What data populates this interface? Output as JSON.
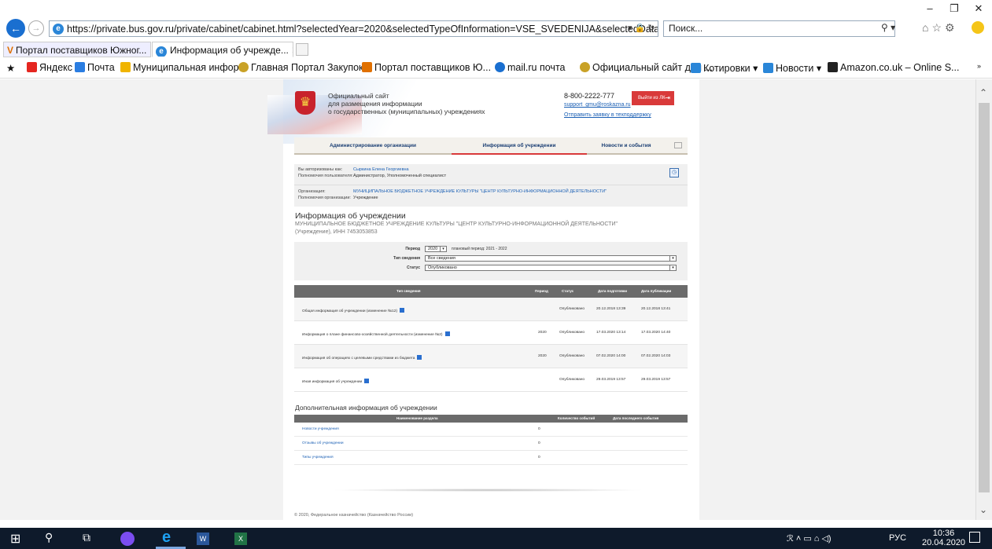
{
  "browser": {
    "url": "https://private.bus.gov.ru/private/cabinet/cabinet.html?selectedYear=2020&selectedTypeOfInformation=VSE_SVEDENIJA&selectedDataStatus=F",
    "search_placeholder": "Поиск...",
    "tabs": [
      {
        "label": "Портал поставщиков Южног..."
      },
      {
        "label": "Информация об учрежде..."
      }
    ],
    "favorites": [
      {
        "label": "Яндекс",
        "color": "#e52620"
      },
      {
        "label": "Почта",
        "color": "#2a7de1"
      },
      {
        "label": "Муниципальная инфор...",
        "color": "#f0b400"
      },
      {
        "label": "Главная Портал Закупок",
        "color": "#c9a227"
      },
      {
        "label": "Портал поставщиков Ю...",
        "color": "#e07000"
      },
      {
        "label": "mail.ru почта",
        "color": "#1a6fd0"
      },
      {
        "label": "Официальный сайт для ...",
        "color": "#c9a227"
      },
      {
        "label": "Котировки ▾",
        "color": "#2a86d8"
      },
      {
        "label": "Новости ▾",
        "color": "#2a86d8"
      },
      {
        "label": "Amazon.co.uk – Online S...",
        "color": "#222222"
      }
    ]
  },
  "site": {
    "title_line1": "Официальный сайт",
    "title_line2": "для размещения информации",
    "title_line3": "о государственных (муниципальных) учреждениях",
    "phone": "8-800-2222-777",
    "support_email": "support_gmu@roskazna.ru",
    "support_request": "Отправить заявку в техподдержку",
    "logout": "Выйти из ЛК"
  },
  "nav": {
    "admin": "Администрирование организации",
    "info": "Информация об учреждении",
    "news": "Новости и события"
  },
  "user": {
    "auth_label": "Вы авторизованы как:",
    "auth_value": "Сыркина Елена Георгиевна",
    "rights_label": "Полномочия пользователя:",
    "rights_value": "Администратор, Уполномоченный специалист",
    "org_label": "Организация:",
    "org_value": "МУНИЦИПАЛЬНОЕ БЮДЖЕТНОЕ УЧРЕЖДЕНИЕ КУЛЬТУРЫ \"ЦЕНТР КУЛЬТУРНО-ИНФОРМАЦИОННОЙ ДЕЯТЕЛЬНОСТИ\"",
    "org_rights_label": "Полномочия организации:",
    "org_rights_value": "Учреждение"
  },
  "info": {
    "title": "Информация об учреждении",
    "org_name": "МУНИЦИПАЛЬНОЕ БЮДЖЕТНОЕ УЧРЕЖДЕНИЕ КУЛЬТУРЫ \"ЦЕНТР КУЛЬТУРНО-ИНФОРМАЦИОННОЙ ДЕЯТЕЛЬНОСТИ\" (Учреждение), ИНН 7453053853"
  },
  "filters": {
    "period_label": "Период",
    "period_value": "2020",
    "planned_period": "плановый период: 2021 - 2022",
    "type_label": "Тип сведения",
    "type_value": "Все сведения",
    "status_label": "Статус",
    "status_value": "Опубликовано"
  },
  "info_table": {
    "headers": {
      "type": "Тип сведения",
      "period": "Период",
      "status": "Статус",
      "prep_date": "Дата подготовки",
      "pub_date": "Дата публикации"
    },
    "rows": [
      {
        "name": "Общая информация об учреждении (изменение №12)",
        "period": "",
        "status": "Опубликовано",
        "prep": "20.12.2018 13:39",
        "pub": "20.12.2018 13:41"
      },
      {
        "name": "Информация о плане финансово-хозяйственной деятельности (изменение №2)",
        "period": "2020",
        "status": "Опубликовано",
        "prep": "17.03.2020 13:14",
        "pub": "17.03.2020 14:40"
      },
      {
        "name": "Информация об операциях с целевыми средствами из бюджета",
        "period": "2020",
        "status": "Опубликовано",
        "prep": "07.02.2020 14:00",
        "pub": "07.02.2020 14:03"
      },
      {
        "name": "Иная информация об учреждении",
        "period": "",
        "status": "Опубликовано",
        "prep": "29.03.2019 13:57",
        "pub": "29.03.2019 13:57"
      }
    ]
  },
  "extra": {
    "title": "Дополнительная информация об учреждении",
    "headers": {
      "section": "Наименование раздела",
      "count": "Количество событий",
      "last_date": "Дата последнего события"
    },
    "rows": [
      {
        "name": "Новости учреждения",
        "count": "0"
      },
      {
        "name": "Отзывы об учреждении",
        "count": "0"
      },
      {
        "name": "Типы учреждения",
        "count": "0"
      }
    ]
  },
  "footer": "© 2020, Федеральное казначейство (Казначейство России)",
  "taskbar": {
    "lang": "РУС",
    "time": "10:36",
    "date": "20.04.2020"
  }
}
